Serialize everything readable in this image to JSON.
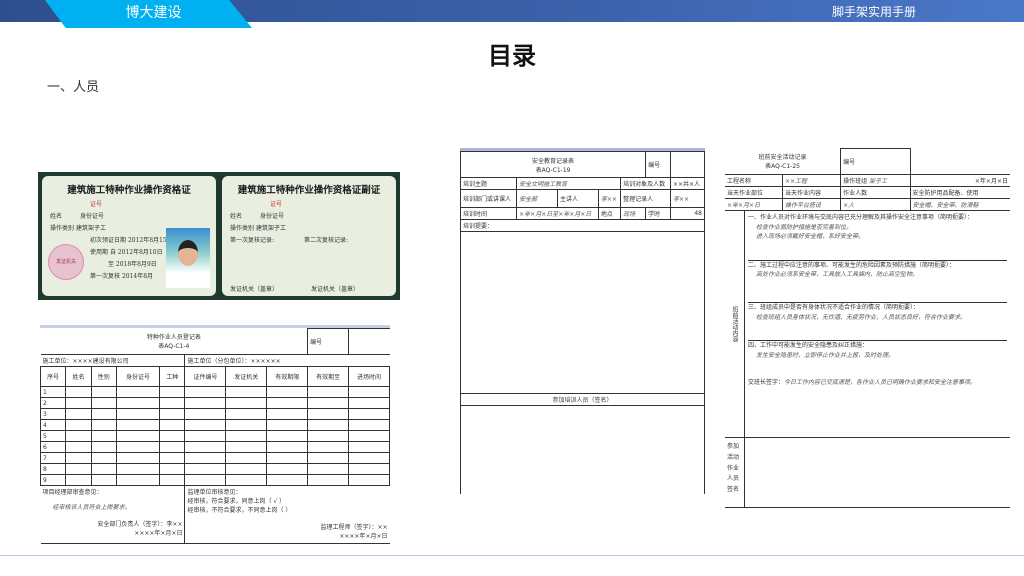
{
  "header": {
    "brand": "博大建设",
    "manual_title": "脚手架实用手册"
  },
  "page": {
    "title": "目录",
    "section": "一、人员"
  },
  "certificate": {
    "front_title": "建筑施工特种作业操作资格证",
    "cert_no_label": "证号",
    "name_label": "姓名",
    "id_label": "身份证号",
    "type_label": "操作类别",
    "type_value": "建筑架子工",
    "first_issue_label": "初次领证日期",
    "first_issue": "2012年8月15日",
    "valid_label": "使用期",
    "valid_from": "自 2012年8月10日",
    "valid_to": "至 2018年8月9日",
    "review_label": "第一次复核",
    "review": "2014年8月",
    "seal": "发证机关",
    "back_title": "建筑施工特种作业操作资格证副证",
    "first_review": "第一次复核记录:",
    "second_review": "第二次复核记录:",
    "issuer1": "发证机关（盖章）",
    "issuer2": "发证机关（盖章）"
  },
  "form1": {
    "title": "特种作业人员登记表",
    "code": "表AQ-C1-4",
    "no_label": "编号",
    "unit": "施工单位：××××建设有限公司",
    "project": "施工单位（分包单位）：××××××",
    "columns": [
      "序号",
      "姓名",
      "性别",
      "身份证号",
      "工种",
      "证件编号",
      "发证机关",
      "有效期限",
      "有效期至",
      "进场时间"
    ],
    "rows": [
      "1",
      "2",
      "3",
      "4",
      "5",
      "6",
      "7",
      "8",
      "9"
    ],
    "opinion_label": "项目经理部审查意见：",
    "opinion": "经审核该人员符合上岗要求。",
    "signer1": "安全部门负责人（签字）：李××",
    "date1": "××××年×月×日",
    "check_label": "监理单位审核意见：",
    "check1": "经审核，符合要求，同意上岗（ √ ）",
    "check2": "经审核，不符合要求，不同意上岗（ ）",
    "signer2": "监理工程师（签字）：××",
    "date2": "××××年×月×日"
  },
  "form2": {
    "title": "安全教育记录表",
    "code": "表AQ-C1-19",
    "no_label": "编号",
    "topic_label": "培训主题",
    "topic": "安全文明施工教育",
    "count_label": "培训对象及人数",
    "count": "××共×人",
    "dept_label": "培训部门或讲课人",
    "dept": "安全部",
    "trainer_label": "主讲人",
    "trainer": "李××",
    "recorder_label": "整理记录人",
    "recorder": "李××",
    "time_label": "培训时间",
    "time": "×年×月×日至×年×月×日",
    "place_label": "地点",
    "place": "现场",
    "hours_label": "学时",
    "hours": "48",
    "summary_label": "培训提要：",
    "sign_label": "参加培训人员（签名）"
  },
  "form3": {
    "title": "班前安全活动记录",
    "code": "表AQ-C1-25",
    "no_label": "编号",
    "proj_label": "工程名称",
    "proj": "××工程",
    "team_label": "操作班组",
    "team": "架子工",
    "date": "×年×月×日",
    "part_label": "当天作业部位",
    "part": "当天作业内容",
    "people_label": "作业人数",
    "people": "安全防护用品配备、使用",
    "r1a": "×年×月×日",
    "r1b": "操作平台搭设",
    "r1c": "×人",
    "r1d": "安全帽、安全带、防滑鞋",
    "content_label": "班前活动内容",
    "s1": "一、作业人员对作业环境与交底内容已充分理解及其操作安全注意事项（简明扼要）：",
    "s1t1": "检查作业面防护措施是否完善到位。",
    "s1t2": "进入现场必须戴好安全帽，系好安全带。",
    "s2": "二、施工过程中应注意的事项、可能发生的危险因素及预防措施（简明扼要）：",
    "s2t": "高处作业必须系安全带，工具放入工具袋内，防止高空坠物。",
    "s3": "三、班组成员中是否有身体状况不适合作业的情况（简明扼要）：",
    "s3t": "检查班组人员身体状况，无饮酒、无疲劳作业，人员状态良好，符合作业要求。",
    "s4": "四、工作中可能发生的安全隐患及纠正措施：",
    "s4t": "发生安全隐患时，立即停止作业并上报，及时处理。",
    "s5": "交班长签字：",
    "s5t": "今日工作内容已交底清楚，各作业人员已明确作业要求和安全注意事项。",
    "attend_label": "参加活动作业人员签名"
  }
}
